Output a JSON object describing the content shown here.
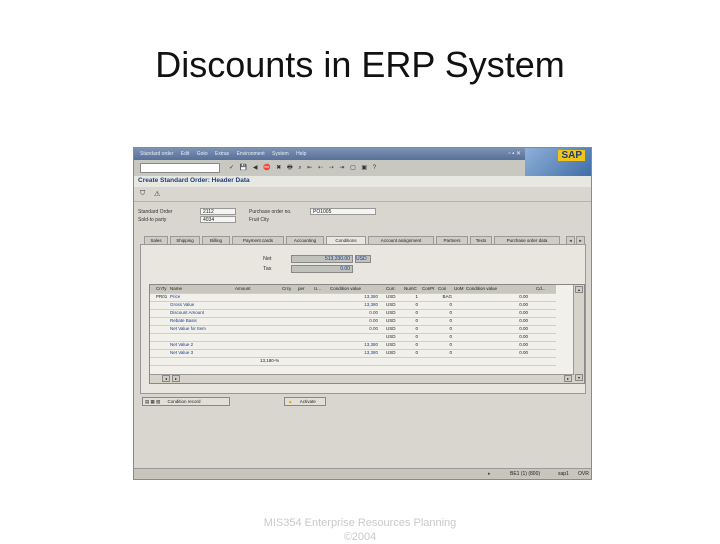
{
  "slide": {
    "title": "Discounts in ERP System",
    "footer_line1": "MIS354 Enterprise Resources Planning",
    "footer_line2": "©2004"
  },
  "sap": {
    "menu": [
      "Standard order",
      "Edit",
      "Goto",
      "Extras",
      "Environment",
      "System",
      "Help"
    ],
    "logo": "SAP",
    "screen_title": "Create Standard Order: Header Data",
    "header": {
      "standard_order_label": "Standard Order",
      "standard_order_value": "2112",
      "sold_to_label": "Sold-to party",
      "sold_to_value": "4034",
      "po_label": "Purchase order no.",
      "po_value": "PO1005",
      "sold_to_name": "Fruit City"
    },
    "tabs": [
      "Sales",
      "Shipping",
      "Billing",
      "Payment cards",
      "Accounting",
      "Conditions",
      "Account assignment",
      "Partners",
      "Texts",
      "Purchase order data"
    ],
    "summary": {
      "net_label": "Net",
      "net_value": "513,330.00",
      "currency": "USD",
      "tax_label": "Tax",
      "tax_value": "0.00"
    },
    "grid": {
      "headers": [
        "CnTy",
        "Name",
        "Amount",
        "Crcy",
        "per",
        "U...",
        "Condition value",
        "Curr.",
        "NumC",
        "ConPr",
        "Con",
        "UoM",
        "Condition value",
        "Cd..."
      ],
      "rows": [
        {
          "type": "PR01",
          "name": "Price",
          "value": "13,380",
          "unit": "USD",
          "n1": "1",
          "n2": "BAG",
          "val2": "0.00"
        },
        {
          "type": "",
          "name": "Gross Value",
          "value": "13,380",
          "unit": "USD",
          "n1": "0",
          "n2": "0",
          "val2": "0.00"
        },
        {
          "type": "",
          "name": "Discount Amount",
          "value": "0.00",
          "unit": "USD",
          "n1": "0",
          "n2": "0",
          "val2": "0.00"
        },
        {
          "type": "",
          "name": "Rebate Basis",
          "value": "0.00",
          "unit": "USD",
          "n1": "0",
          "n2": "0",
          "val2": "0.00"
        },
        {
          "type": "",
          "name": "Net Value for Item",
          "value": "0.00",
          "unit": "USD",
          "n1": "0",
          "n2": "0",
          "val2": "0.00"
        },
        {
          "type": "",
          "name": "",
          "value": "",
          "unit": "USD",
          "n1": "0",
          "n2": "0",
          "val2": "0.00"
        },
        {
          "type": "",
          "name": "Net Value 2",
          "value": "13,380",
          "unit": "USD",
          "n1": "0",
          "n2": "0",
          "val2": "0.00"
        },
        {
          "type": "",
          "name": "Net Value 3",
          "value": "13,380",
          "unit": "USD",
          "n1": "0",
          "n2": "0",
          "val2": "0.00"
        },
        {
          "type": "",
          "name": "",
          "value": "",
          "unit": "",
          "n1": "",
          "n2": "",
          "val2": "",
          "amount": "13,180-%"
        }
      ]
    },
    "buttons": {
      "condition_record": "Condition record",
      "activate": "Activate"
    },
    "status": {
      "system": "BE1 (1) (800)",
      "server": "sap1",
      "mode": "OVR"
    }
  }
}
